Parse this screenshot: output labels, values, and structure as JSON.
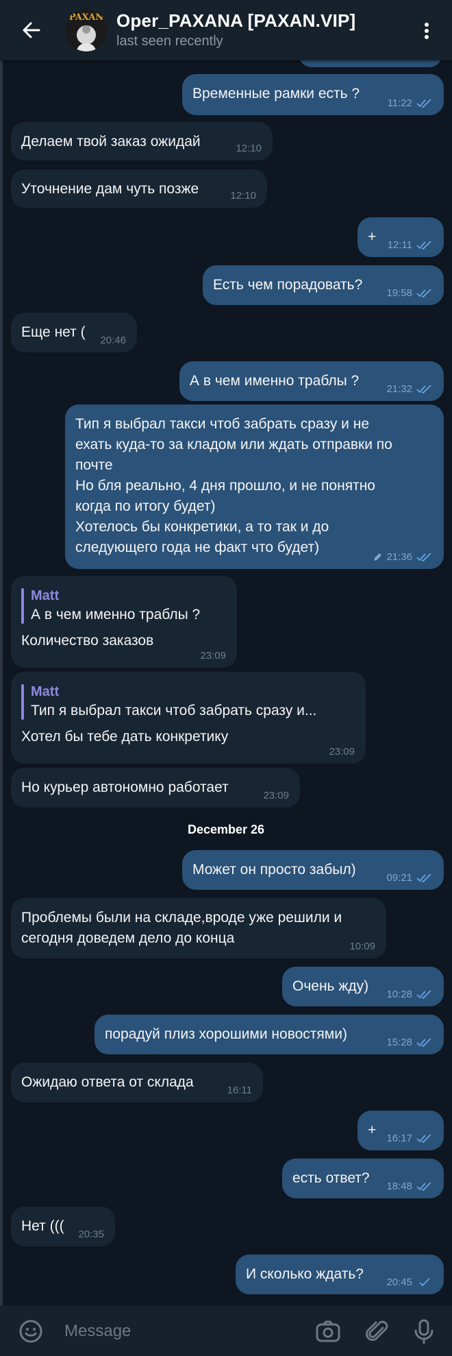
{
  "header": {
    "title": "Oper_PAXANA [PAXAN.VIP]",
    "status": "last seen recently",
    "avatar_text": "PAXAN"
  },
  "messages": [
    {
      "dir": "out",
      "text": "Временные рамки есть ?",
      "time": "11:22",
      "read": true
    },
    {
      "dir": "in",
      "text": "Делаем твой заказ ожидай",
      "time": "12:10"
    },
    {
      "dir": "in",
      "text": "Уточнение дам чуть позже",
      "time": "12:10"
    },
    {
      "dir": "out",
      "text": "+",
      "time": "12:11",
      "read": true
    },
    {
      "dir": "out",
      "text": "Есть чем порадовать?",
      "time": "19:58",
      "read": true
    },
    {
      "dir": "in",
      "text": "Еще нет (",
      "time": "20:46"
    },
    {
      "dir": "out",
      "text": "А в чем именно траблы ?",
      "time": "21:32",
      "read": true
    },
    {
      "dir": "out",
      "lines": [
        "Тип я выбрал такси чтоб забрать сразу и не",
        "ехать куда-то за кладом или ждать отправки по",
        "почте",
        "Но бля реально, 4 дня прошло, и не понятно",
        "когда по итогу будет)",
        "Хотелось бы конкретики, а то так и до",
        "следующего года не факт что будет)"
      ],
      "time": "21:36",
      "edited": true,
      "read": true
    },
    {
      "dir": "in",
      "reply_name": "Matt",
      "reply_text": "А в чем именно траблы ?",
      "text": "Количество заказов",
      "time": "23:09"
    },
    {
      "dir": "in",
      "reply_name": "Matt",
      "reply_text": "Тип я выбрал такси чтоб забрать сразу и...",
      "text": "Хотел бы тебе дать конкретику",
      "time": "23:09"
    },
    {
      "dir": "in",
      "text": "Но курьер автономно работает",
      "time": "23:09"
    },
    {
      "dir": "out",
      "text": "Может он просто забыл)",
      "time": "09:21",
      "read": true
    },
    {
      "dir": "in",
      "lines": [
        "Проблемы были на складе,вроде уже решили и",
        "сегодня доведем дело до конца"
      ],
      "time": "10:09"
    },
    {
      "dir": "out",
      "text": "Очень жду)",
      "time": "10:28",
      "read": true
    },
    {
      "dir": "out",
      "text": "порадуй плиз хорошими новостями)",
      "time": "15:28",
      "read": true
    },
    {
      "dir": "in",
      "text": "Ожидаю ответа от склада",
      "time": "16:11"
    },
    {
      "dir": "out",
      "text": "+",
      "time": "16:17",
      "read": true
    },
    {
      "dir": "out",
      "text": "есть ответ?",
      "time": "18:48",
      "read": true
    },
    {
      "dir": "in",
      "text": "Нет (((",
      "time": "20:35"
    },
    {
      "dir": "out",
      "text": "И сколько ждать?",
      "time": "20:45",
      "read": false
    }
  ],
  "date_divider": "December 26",
  "composer": {
    "placeholder": "Message"
  },
  "colors": {
    "background": "#0e1621",
    "incoming": "#182533",
    "outgoing": "#2b5278",
    "accent": "#8f87e0",
    "header": "#17212b"
  },
  "icons": [
    "back-arrow-icon",
    "more-vert-icon",
    "emoji-icon",
    "camera-icon",
    "attach-icon",
    "mic-icon",
    "double-check-icon",
    "single-check-icon",
    "pencil-icon"
  ]
}
